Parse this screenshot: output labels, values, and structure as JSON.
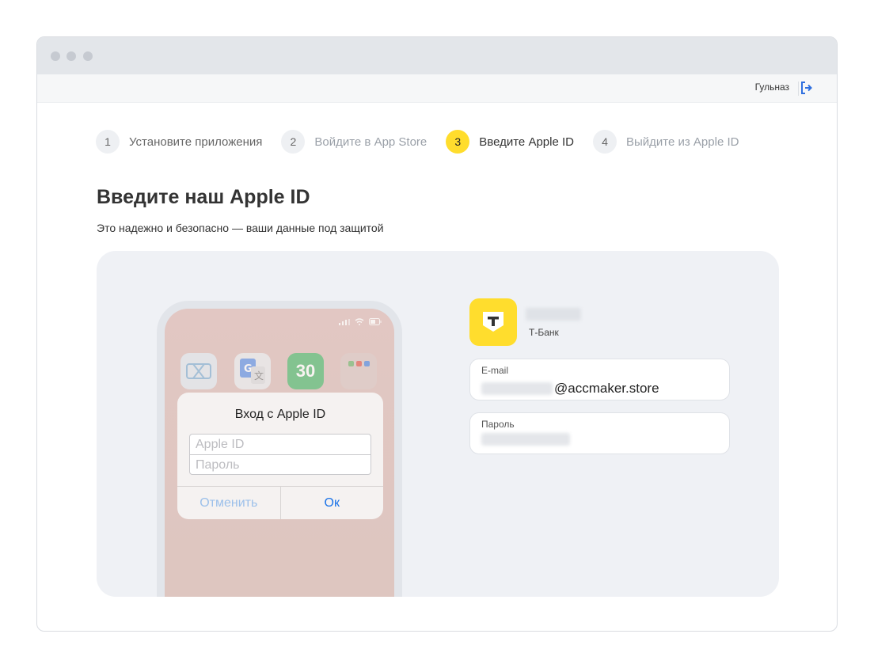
{
  "header": {
    "user_name": "Гульназ"
  },
  "steps": [
    {
      "number": "1",
      "label": "Установите приложения"
    },
    {
      "number": "2",
      "label": "Войдите в App Store"
    },
    {
      "number": "3",
      "label": "Введите Apple ID"
    },
    {
      "number": "4",
      "label": "Выйдите из Apple ID"
    }
  ],
  "main": {
    "title": "Введите наш Apple ID",
    "subtitle": "Это надежно и безопасно — ваши данные под защитой"
  },
  "phone": {
    "app_badge": "30",
    "dialog": {
      "title": "Вход с Apple ID",
      "apple_id_placeholder": "Apple ID",
      "password_placeholder": "Пароль",
      "cancel": "Отменить",
      "ok": "Ок"
    }
  },
  "account": {
    "bank_name": "Т-Банк",
    "email_label": "E-mail",
    "email_domain": "@accmaker.store",
    "password_label": "Пароль"
  },
  "colors": {
    "accent_yellow": "#ffdd2d",
    "link_blue": "#1a73e8",
    "panel_bg": "#eff1f5"
  }
}
